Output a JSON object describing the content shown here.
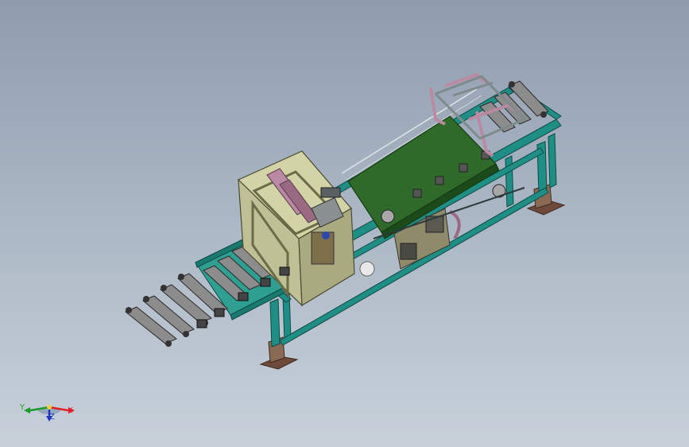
{
  "viewport": {
    "background_top": "#8f9cad",
    "background_bottom": "#c8d1da"
  },
  "model": {
    "frame_color": "#1f8f86",
    "belt_color": "#2f6a2a",
    "head_color": "#c9c99a",
    "arm_color": "#b98aa2",
    "roller_color": "#9a9a9a",
    "base_color": "#7a5a4a"
  },
  "triad": {
    "x_label": "X",
    "y_label": "Y",
    "z_label": "Z",
    "x_color": "#e0202a",
    "y_color": "#1a9a2a",
    "z_color": "#2030c0"
  }
}
